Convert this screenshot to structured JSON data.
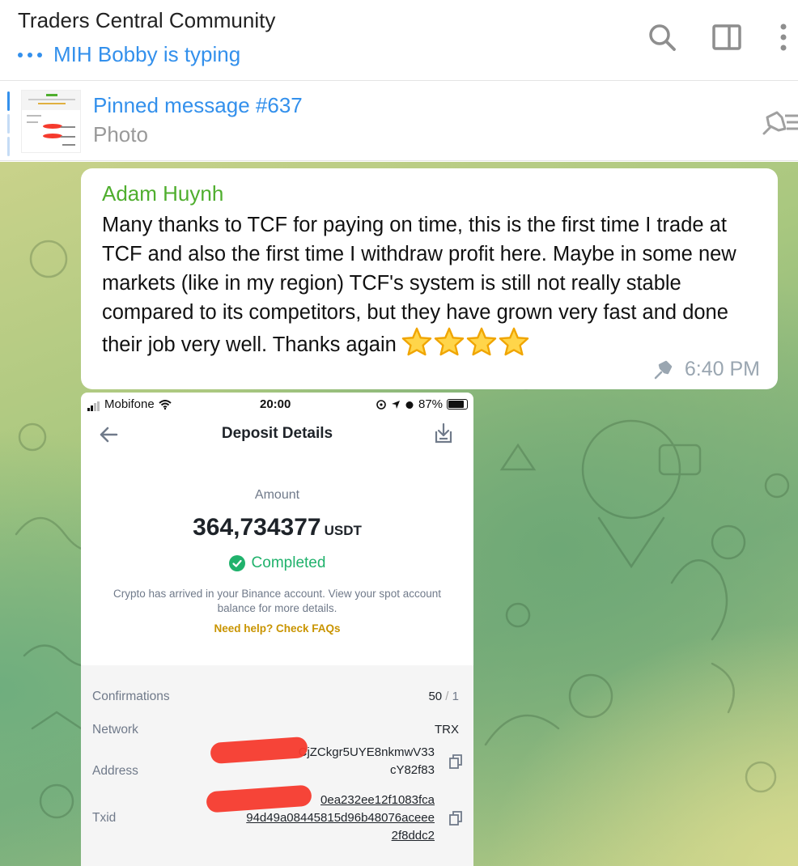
{
  "header": {
    "title": "Traders Central Community",
    "typing": "MIH Bobby is typing",
    "icons": [
      "search-icon",
      "sidebar-toggle-icon",
      "more-vertical-icon"
    ]
  },
  "pinned": {
    "title": "Pinned message #637",
    "subtitle": "Photo",
    "icon": "pin-list-icon"
  },
  "message": {
    "sender": "Adam Huynh",
    "text": "Many thanks to TCF for paying on time, this is the first time I trade at TCF and also the first time I withdraw profit here.  Maybe in some new markets (like in my region) TCF's system is still not really stable compared to its competitors, but they have grown very fast and done their job very well.  Thanks again",
    "stars": 4,
    "time": "6:40 PM",
    "pinned": true
  },
  "photo": {
    "status_bar": {
      "carrier": "Mobifone",
      "time": "20:00",
      "battery": "87%"
    },
    "title": "Deposit Details",
    "amount_label": "Amount",
    "amount": "364,734377",
    "unit": "USDT",
    "status": "Completed",
    "description": "Crypto has arrived in your Binance account. View your spot account balance for more details.",
    "help_link": "Need help? Check FAQs",
    "rows": {
      "confirmations": {
        "label": "Confirmations",
        "value_main": "50",
        "value_sep": " / ",
        "value_total": "1"
      },
      "network": {
        "label": "Network",
        "value": "TRX"
      },
      "address": {
        "label": "Address",
        "line1": "CjZCkgr5UYE8nkmwV33",
        "line2": "cY82f83"
      },
      "txid": {
        "label": "Txid",
        "line1": "0ea232ee12f1083fca",
        "line2": "94d49a08445815d96b48076aceee",
        "line3": "2f8ddc2"
      }
    }
  },
  "colors": {
    "accent": "#3390ec",
    "sender": "#4fae2e",
    "completed": "#20b26c",
    "faq": "#c99400",
    "redaction": "#f53a2d"
  }
}
